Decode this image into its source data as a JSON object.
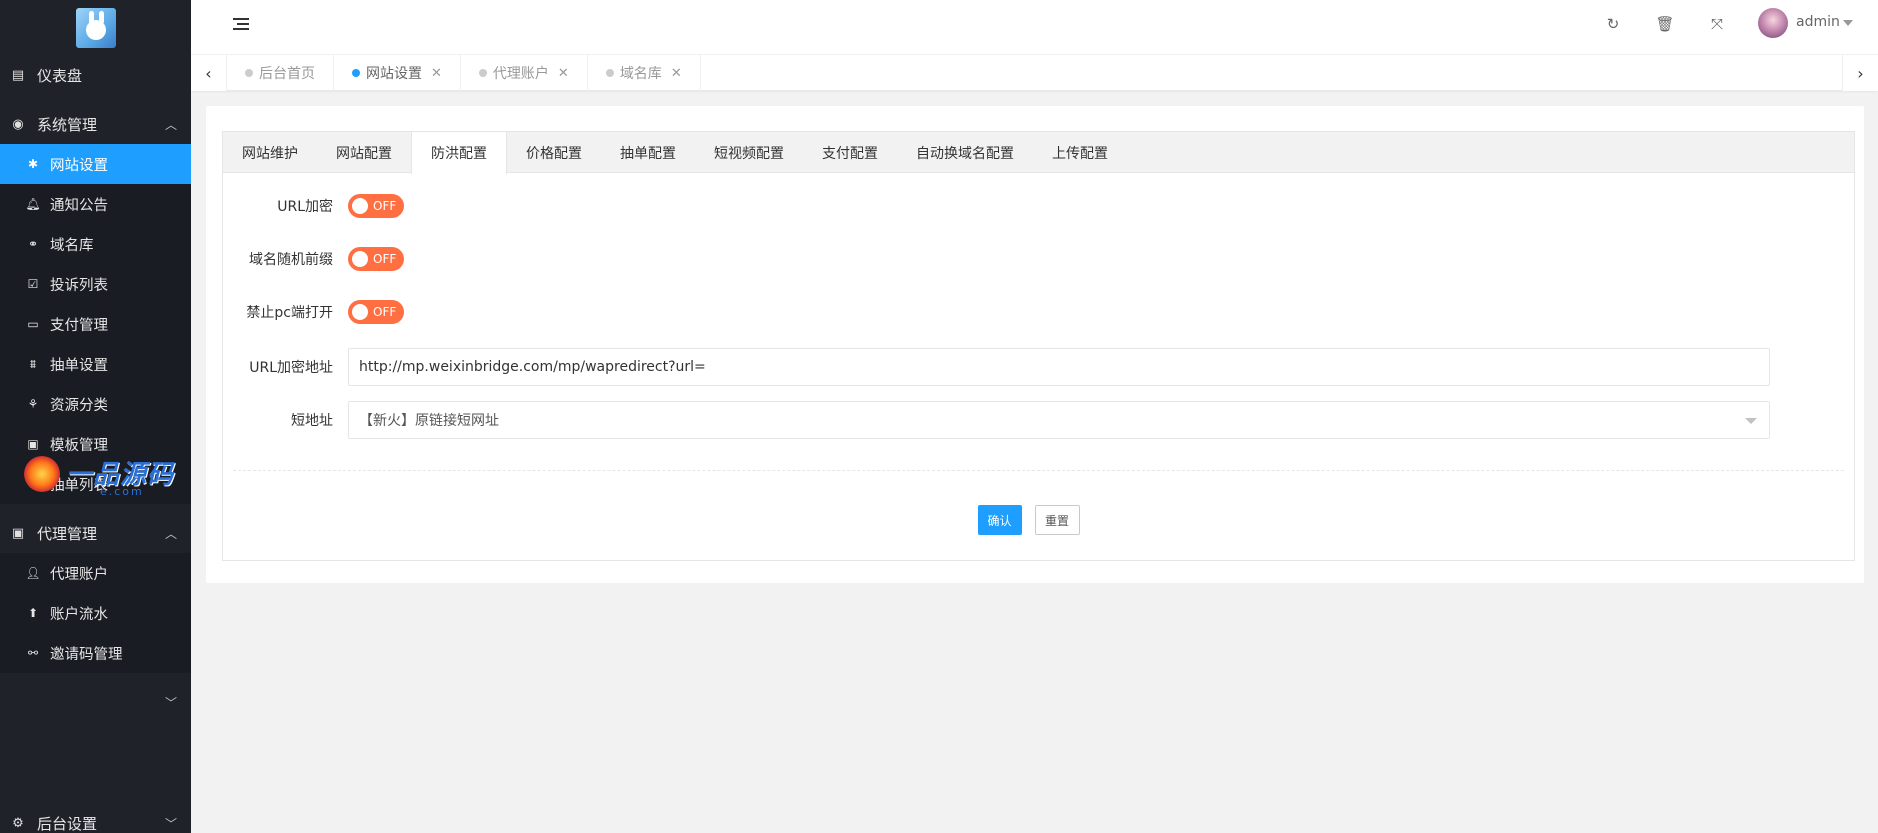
{
  "sidebar": {
    "items": [
      {
        "label": "仪表盘",
        "icon": "book-icon"
      },
      {
        "label": "系统管理",
        "icon": "circle-dot-icon"
      },
      {
        "label": "代理管理",
        "icon": "contact-book-icon"
      },
      {
        "label": "后台设置",
        "icon": "gears-icon"
      }
    ],
    "system_children": [
      {
        "label": "网站设置",
        "icon": "asterisk-icon"
      },
      {
        "label": "通知公告",
        "icon": "bell-icon"
      },
      {
        "label": "域名库",
        "icon": "link-icon"
      },
      {
        "label": "投诉列表",
        "icon": "check-square-icon"
      },
      {
        "label": "支付管理",
        "icon": "credit-card-icon"
      },
      {
        "label": "抽单设置",
        "icon": "bank-icon"
      },
      {
        "label": "资源分类",
        "icon": "plant-icon"
      },
      {
        "label": "模板管理",
        "icon": "template-icon"
      },
      {
        "label": "抽单列表",
        "icon": "hand-icon"
      }
    ],
    "agent_children": [
      {
        "label": "代理账户",
        "icon": "user-icon"
      },
      {
        "label": "账户流水",
        "icon": "arrow-up-circle-icon"
      },
      {
        "label": "邀请码管理",
        "icon": "handshake-icon"
      }
    ]
  },
  "watermark": {
    "text": "一品源码",
    "sub": "e.com"
  },
  "header": {
    "user": "admin"
  },
  "page_tabs": [
    {
      "label": "后台首页",
      "closable": false
    },
    {
      "label": "网站设置",
      "closable": true
    },
    {
      "label": "代理账户",
      "closable": true
    },
    {
      "label": "域名库",
      "closable": true
    }
  ],
  "inner_tabs": [
    "网站维护",
    "网站配置",
    "防洪配置",
    "价格配置",
    "抽单配置",
    "短视频配置",
    "支付配置",
    "自动换域名配置",
    "上传配置"
  ],
  "form": {
    "url_encrypt_label": "URL加密",
    "random_prefix_label": "域名随机前缀",
    "block_pc_label": "禁止pc端打开",
    "switch_off": "OFF",
    "url_encrypt_addr_label": "URL加密地址",
    "url_encrypt_addr_value": "http://mp.weixinbridge.com/mp/wapredirect?url=",
    "short_url_label": "短地址",
    "short_url_value": "【新火】原链接短网址",
    "confirm": "确认",
    "reset": "重置"
  },
  "colors": {
    "accent": "#1e9fff",
    "sidebar": "#20222a",
    "switch_off": "#ff5722"
  }
}
